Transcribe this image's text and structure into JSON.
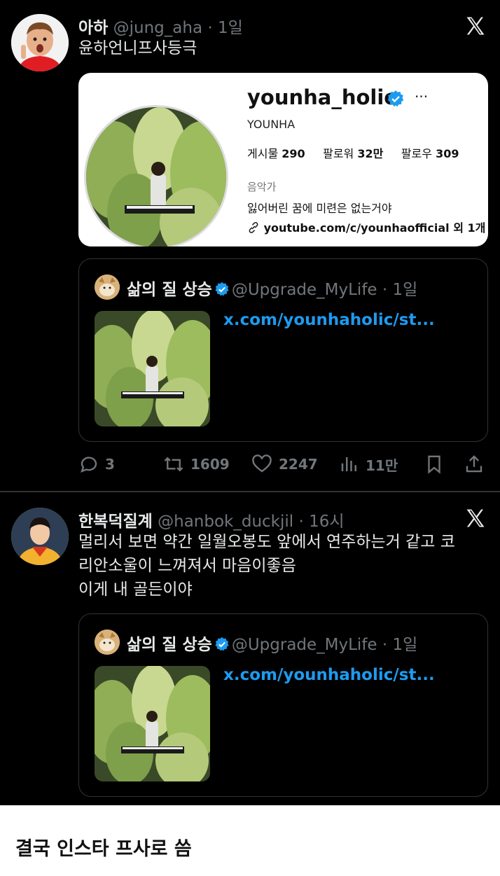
{
  "tweets": [
    {
      "author_name": "아하",
      "handle": "@jung_aha",
      "time": "1일",
      "lines": [
        "윤하언니프사등극"
      ],
      "instagram_card": {
        "username": "younha_holic",
        "real_name": "YOUNHA",
        "posts_label": "게시물",
        "posts_count": "290",
        "followers_label": "팔로워",
        "followers_count": "32만",
        "following_label": "팔로우",
        "following_count": "309",
        "category": "음악가",
        "bio": "잃어버린 꿈에 미련은 없는거야",
        "link": "youtube.com/c/younhaofficial",
        "link_extra": "외 1개"
      },
      "quote": {
        "author_name": "삶의 질 상승",
        "handle": "@Upgrade_MyLife",
        "time": "1일",
        "link": "x.com/younhaholic/st..."
      },
      "actions": {
        "replies": "3",
        "retweets": "1609",
        "likes": "2247",
        "views": "11만"
      }
    },
    {
      "author_name": "한복덕질계",
      "handle": "@hanbok_duckjil",
      "time": "16시",
      "lines": [
        "멀리서 보면 약간 일월오봉도 앞에서 연주하는거 같고 코",
        "리안소울이 느껴져서 마음이좋음",
        "이게 내 골든이야"
      ],
      "quote": {
        "author_name": "삶의 질 상승",
        "handle": "@Upgrade_MyLife",
        "time": "1일",
        "link": "x.com/younhaholic/st..."
      }
    }
  ],
  "caption": "결국 인스타 프사로 씀",
  "colors": {
    "background": "#000000",
    "text": "#e7e9ea",
    "muted": "#71767b",
    "link": "#1d9bf0",
    "verified": "#1d9bf0"
  }
}
